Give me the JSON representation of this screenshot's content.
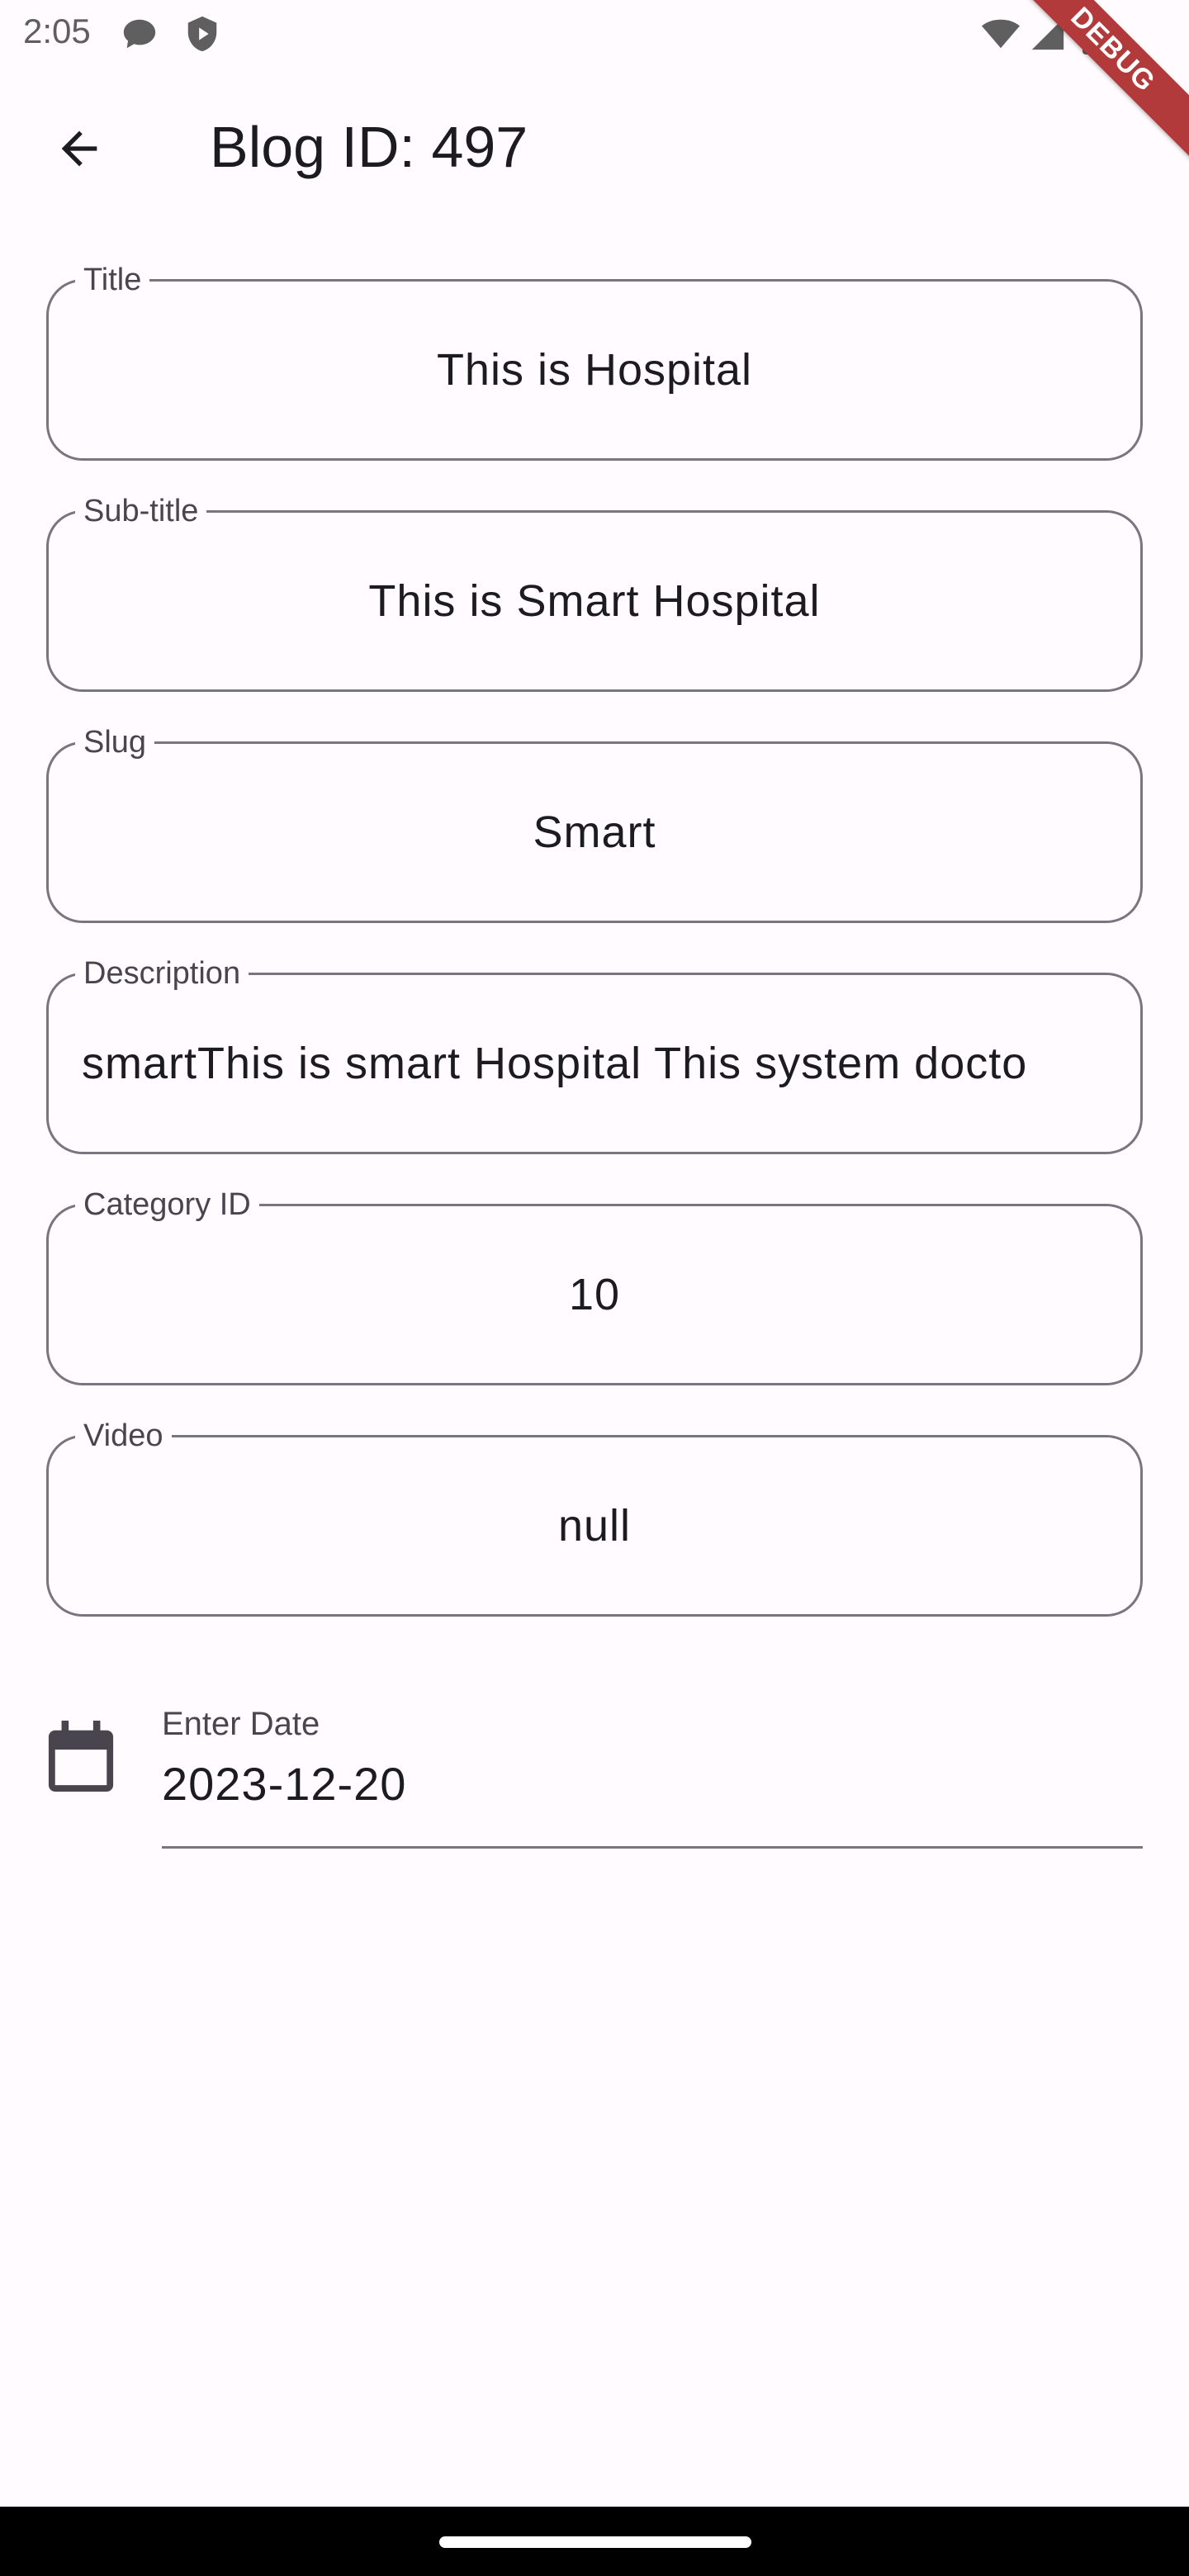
{
  "status_bar": {
    "time": "2:05",
    "icons": [
      "chat-bubble-icon",
      "shield-play-icon",
      "wifi-icon",
      "cellular-signal-icon",
      "battery-icon"
    ]
  },
  "debug_banner": "DEBUG",
  "app_bar": {
    "back_icon": "arrow-back-icon",
    "title": "Blog ID: 497"
  },
  "form": {
    "fields": [
      {
        "label": "Title",
        "value": "This is Hospital"
      },
      {
        "label": "Sub-title",
        "value": "This is Smart Hospital"
      },
      {
        "label": "Slug",
        "value": "Smart"
      },
      {
        "label": "Description",
        "value": "smartThis is smart Hospital This system docto"
      },
      {
        "label": "Category ID",
        "value": "10"
      },
      {
        "label": "Video",
        "value": "null"
      }
    ],
    "date": {
      "icon": "calendar-icon",
      "label": "Enter Date",
      "value": "2023-12-20"
    }
  },
  "colors": {
    "background": "#FFFBFE",
    "outline": "#79747E",
    "label": "#49454F",
    "text": "#1C1B1F",
    "debug_banner": "#B23A3A"
  }
}
